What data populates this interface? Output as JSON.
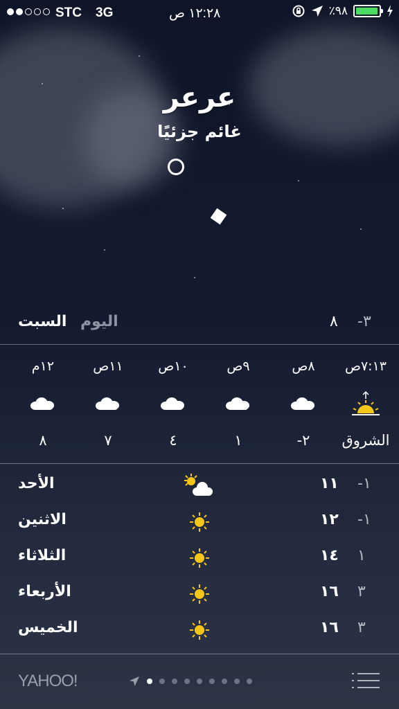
{
  "status": {
    "carrier": "STC",
    "network": "3G",
    "time": "١٢:٢٨ ص",
    "battery": "٪٩٨",
    "signal_bars": 2,
    "battery_color": "#4cd964"
  },
  "location": {
    "city": "عرعر",
    "condition": "غائم جزئيًا"
  },
  "today": {
    "day": "السبت",
    "label": "اليوم",
    "high": "٨",
    "low": "-٣"
  },
  "hourly": [
    {
      "time": "٧:١٣ص",
      "icon": "sunrise-icon",
      "value": "الشروق"
    },
    {
      "time": "٨ص",
      "icon": "cloud-icon",
      "value": "-٢"
    },
    {
      "time": "٩ص",
      "icon": "cloud-icon",
      "value": "١"
    },
    {
      "time": "١٠ص",
      "icon": "cloud-icon",
      "value": "٤"
    },
    {
      "time": "١١ص",
      "icon": "cloud-icon",
      "value": "٧"
    },
    {
      "time": "١٢م",
      "icon": "cloud-icon",
      "value": "٨"
    }
  ],
  "daily": [
    {
      "day": "الأحد",
      "icon": "partly-cloudy-icon",
      "high": "١١",
      "low": "-١"
    },
    {
      "day": "الاثنين",
      "icon": "sun-icon",
      "high": "١٢",
      "low": "-١"
    },
    {
      "day": "الثلاثاء",
      "icon": "sun-icon",
      "high": "١٤",
      "low": "١"
    },
    {
      "day": "الأربعاء",
      "icon": "sun-icon",
      "high": "١٦",
      "low": "٣"
    },
    {
      "day": "الخميس",
      "icon": "sun-icon",
      "high": "١٦",
      "low": "٣"
    }
  ],
  "footer": {
    "brand": "YAHOO!",
    "page_count": 9,
    "active_page": 0
  },
  "colors": {
    "sun": "#f5c518",
    "muted_text": "#8e93a4"
  }
}
